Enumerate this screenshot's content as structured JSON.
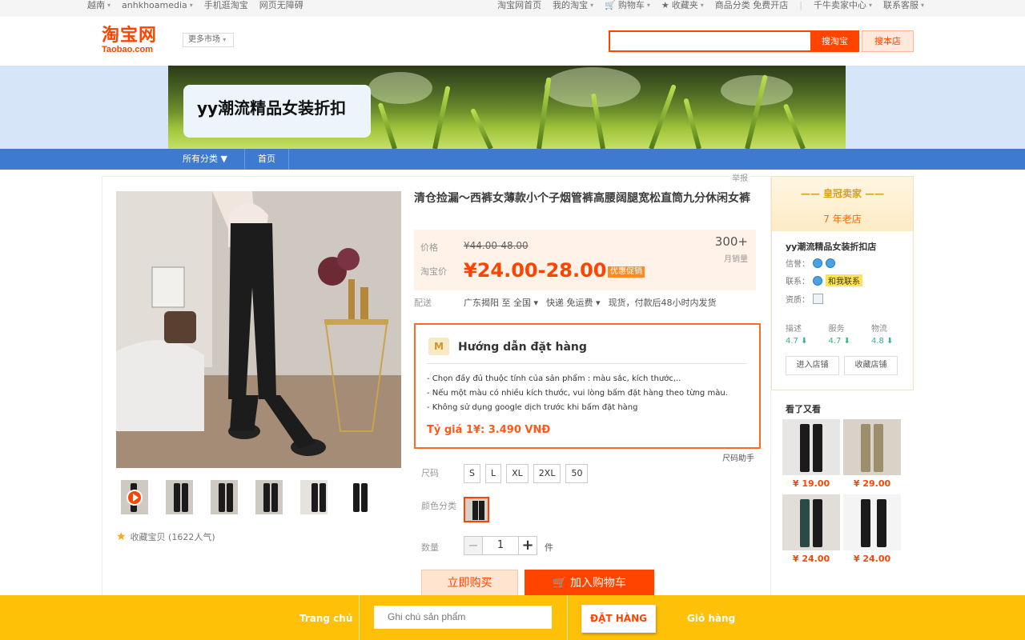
{
  "topbar": {
    "region": "越南",
    "user": "anhkhoamedia",
    "mobile": "手机逛淘宝",
    "open_shop": "网页无障碍",
    "home": "淘宝网首页",
    "my_taobao": "我的淘宝",
    "cart": "购物车",
    "favorites": "收藏夹",
    "categories": "商品分类 免费开店",
    "seller_center": "千牛卖家中心",
    "support": "联系客服"
  },
  "header": {
    "logo_cn": "淘宝网",
    "logo_en": "Taobao.com",
    "region_select": "更多市场",
    "search_value": "",
    "search_button": "搜淘宝",
    "search_shop_button": "搜本店"
  },
  "shop": {
    "name": "yy潮流精品女装折扣",
    "nav_all": "所有分类 ▼",
    "nav_home": "首页"
  },
  "product": {
    "report": "举报",
    "title": "清仓捡漏～西裤女薄款小个子烟管裤高腰阔腿宽松直筒九分休闲女裤",
    "price_label": "价格",
    "old_price": "¥44.00-48.00",
    "promo_label": "淘宝价",
    "new_price": "¥24.00-28.00",
    "promo_badge": "优惠促销",
    "sold_count": "300+",
    "sold_label": "月销量",
    "ship_label": "配送",
    "ship_from": "广东揭阳 至 全国",
    "ship_fee": "快递 免运费",
    "ship_time": "现货，付款后48小时内发货",
    "favorite_count": "收藏宝贝 (1622人气)",
    "size_helper": "尺码助手",
    "size_label": "尺码",
    "sizes": [
      "S",
      "L",
      "XL",
      "2XL",
      "50"
    ],
    "color_label": "颜色分类",
    "qty_label": "数量",
    "qty_value": "1",
    "qty_unit": "件",
    "buy_now": "立即购买",
    "add_cart": "加入购物车"
  },
  "guide": {
    "title": "Hướng dẫn đặt hàng",
    "line1": "- Chọn đầy đủ thuộc tính của sản phẩm : màu sắc, kích thước,..",
    "line2": "- Nếu một màu có nhiều kích thước, vui lòng bấm đặt hàng theo từng màu.",
    "line3": "- Không sử dụng google dịch trước khi bấm đặt hàng",
    "rate": "Tỷ giá 1¥: 3.490 VNĐ"
  },
  "seller": {
    "crown": "—— 皇冠卖家 ——",
    "years": "7 年老店",
    "shop_name": "yy潮流精品女装折扣店",
    "credit_label": "信誉：",
    "contact_label": "联系：",
    "contact_badge": "和我联系",
    "qual_label": "资质：",
    "ratings": [
      {
        "label": "描述",
        "value": "4.7 ⬇"
      },
      {
        "label": "服务",
        "value": "4.7 ⬇"
      },
      {
        "label": "物流",
        "value": "4.8 ⬇"
      }
    ],
    "enter_shop": "进入店铺",
    "fav_shop": "收藏店铺",
    "also_title": "看了又看",
    "also": [
      "¥ 19.00",
      "¥ 29.00",
      "¥ 24.00",
      "¥ 24.00"
    ]
  },
  "bottom": {
    "home": "Trang chủ",
    "note_placeholder": "Ghi chú sản phẩm",
    "order": "ĐẶT HÀNG",
    "cart": "Giỏ hàng"
  },
  "colors": {
    "taobao_orange": "#ff4400",
    "nav_blue": "#3f7ad1",
    "bottom_yellow": "#ffc107"
  }
}
